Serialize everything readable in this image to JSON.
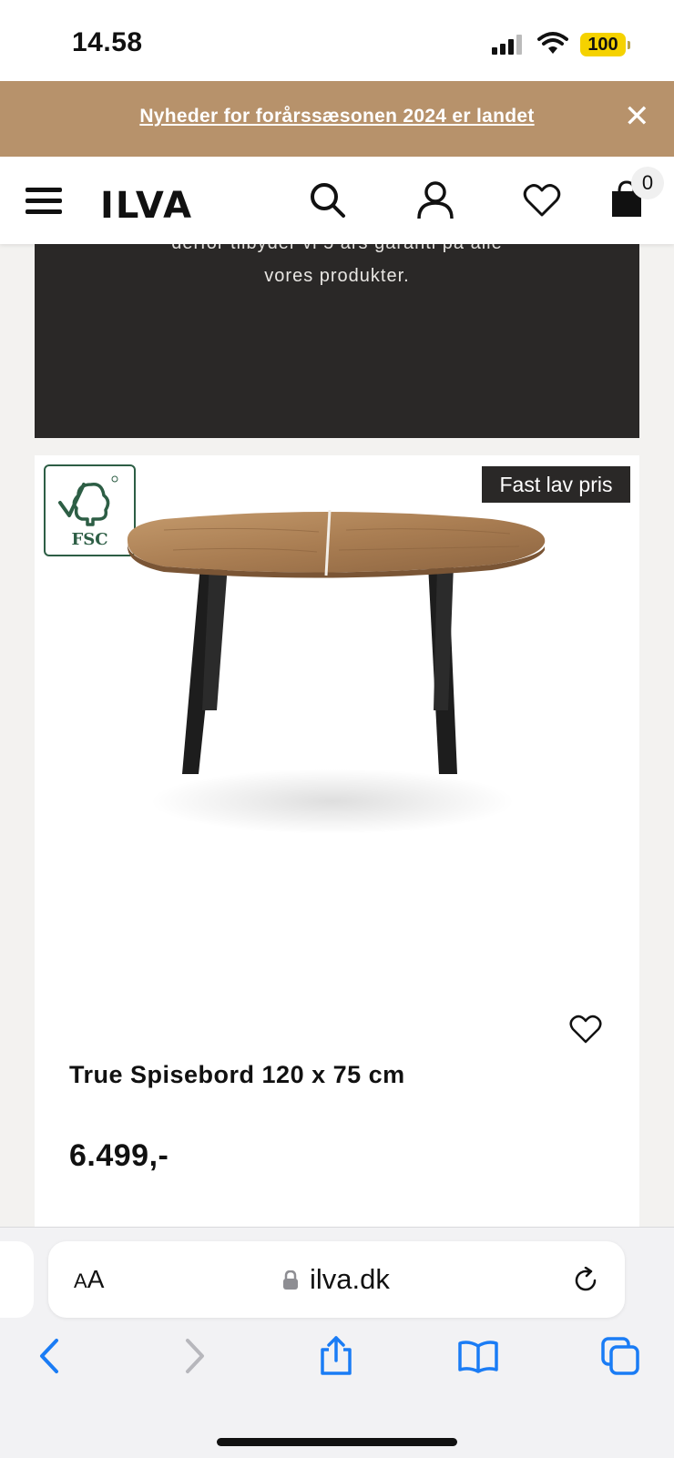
{
  "status_bar": {
    "time": "14.58",
    "battery": "100"
  },
  "promo": {
    "text": "Nyheder for forårssæsonen 2024 er landet",
    "close_glyph": "✕"
  },
  "header": {
    "logo": "ILVA",
    "cart_count": "0"
  },
  "info_box": {
    "line1": "derfor tilbyder vi 5 års garanti på alle",
    "line2": "vores produkter."
  },
  "product": {
    "certification": "FSC",
    "badge": "Fast lav pris",
    "title": "True Spisebord 120 x 75 cm",
    "price": "6.499,-"
  },
  "browser": {
    "text_size_label_small": "A",
    "text_size_label_large": "A",
    "url": "ilva.dk"
  },
  "colors": {
    "promo_bg": "#b7926b",
    "dark_box": "#2a2827",
    "fsc_green": "#2d5e45",
    "safari_blue": "#1a7cf5",
    "battery": "#f5d200"
  },
  "icons": [
    "signal-icon",
    "wifi-icon",
    "close-icon",
    "menu-icon",
    "search-icon",
    "account-icon",
    "heart-icon",
    "shopping-bag-icon",
    "fsc-tree-icon",
    "favorite-icon",
    "lock-icon",
    "reload-icon",
    "back-icon",
    "forward-icon",
    "share-icon",
    "bookmarks-icon",
    "tabs-icon"
  ]
}
